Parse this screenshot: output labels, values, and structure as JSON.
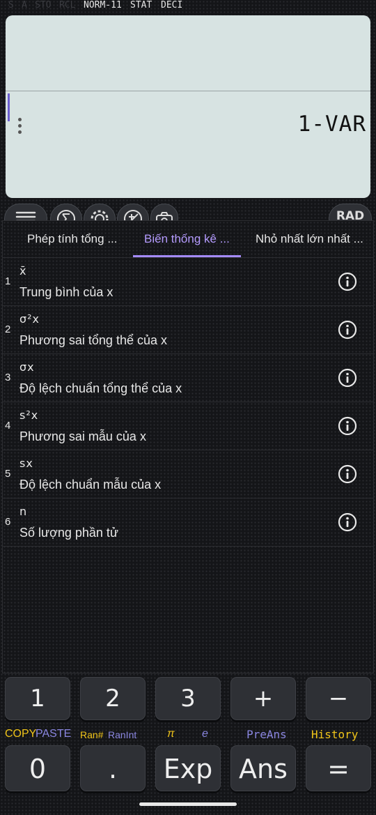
{
  "status_bar": {
    "inactive": [
      "S",
      "A",
      "STO",
      "RCL"
    ],
    "active": [
      "NORM-11",
      "STAT",
      "DECI"
    ]
  },
  "display": {
    "result": "1-VAR"
  },
  "toolbar": {
    "icons": [
      "menu-icon",
      "sigma-icon",
      "gear-icon",
      "plus-minus-icon",
      "camera-icon"
    ],
    "angle_mode": "RAD"
  },
  "tabs": [
    {
      "label": "Phép tính tổng ...",
      "active": false
    },
    {
      "label": "Biến thống kê ...",
      "active": true
    },
    {
      "label": "Nhỏ nhất lớn nhất ...",
      "active": false
    }
  ],
  "stat_vars": [
    {
      "index": "1",
      "symbol": "x̄",
      "description": "Trung bình của x"
    },
    {
      "index": "2",
      "symbol": "σ²x",
      "description": "Phương sai tổng thể của x"
    },
    {
      "index": "3",
      "symbol": "σx",
      "description": "Độ lệch chuẩn tổng thể của x"
    },
    {
      "index": "4",
      "symbol": "s²x",
      "description": "Phương sai mẫu của x"
    },
    {
      "index": "5",
      "symbol": "sx",
      "description": "Độ lệch chuẩn mẫu của x"
    },
    {
      "index": "6",
      "symbol": "n",
      "description": "Số lượng phần tử"
    }
  ],
  "keypad": {
    "row1": [
      "1",
      "2",
      "3",
      "+",
      "−"
    ],
    "row2": [
      "0",
      ".",
      "Exp",
      "Ans",
      "="
    ],
    "function_labels": {
      "copy": "COPY",
      "paste": "PASTE",
      "ran": "Ran#",
      "ranint": "RanInt",
      "pi": "π",
      "e": "e",
      "preans": "PreAns",
      "history": "History"
    }
  },
  "colors": {
    "display_bg": "#d7e3e2",
    "accent": "#a58bff",
    "function_yellow": "#f0c419",
    "function_blue": "#8a86e0"
  }
}
